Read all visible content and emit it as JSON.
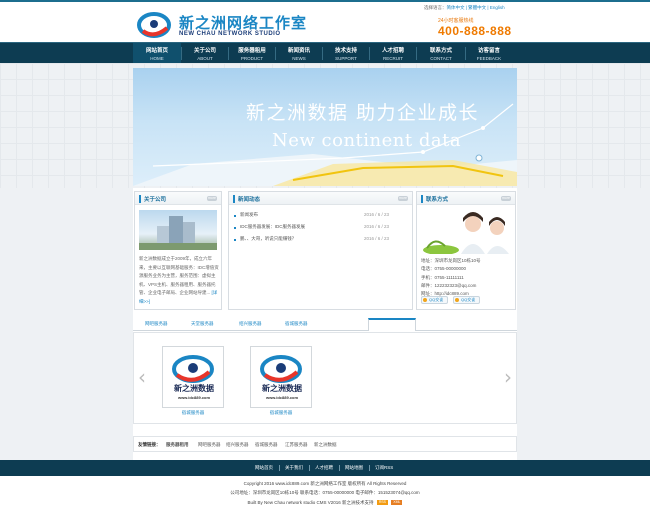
{
  "header": {
    "logo_title": "新之洲网络工作室",
    "logo_sub": "NEW CHAU NETWORK STUDIO",
    "lang_prefix": "选择语言：",
    "lang_options": "简体中文 | 繁體中文 | English",
    "hotline_label": "24小时客服热线",
    "hotline": "400-888-888"
  },
  "nav": [
    {
      "cn": "网站首页",
      "en": "HOME",
      "active": true
    },
    {
      "cn": "关于公司",
      "en": "ABOUT"
    },
    {
      "cn": "服务器租用",
      "en": "PRODUCT"
    },
    {
      "cn": "新闻资讯",
      "en": "NEWS"
    },
    {
      "cn": "技术支持",
      "en": "SUPPORT"
    },
    {
      "cn": "人才招聘",
      "en": "RECRUIT"
    },
    {
      "cn": "联系方式",
      "en": "CONTACT"
    },
    {
      "cn": "访客留言",
      "en": "FEEDBACK"
    }
  ],
  "banner": {
    "cn": "新之洲数据  助力企业成长",
    "en": "New continent data"
  },
  "about": {
    "title": "关于公司",
    "more": "more",
    "text": "新之洲数据成立于2009年，成立六年来，主要以互联网基础服务：IDC增值资源服务业务为主营，服务范围：虚拟主机、VPS主机、服务器租用、服务器托管、企业电子邮局、企业网站导建...",
    "read_more": "[详细>>]"
  },
  "news": {
    "title": "新闻动态",
    "more": "more",
    "items": [
      {
        "title": "新闻发布",
        "date": "2016 / 6 / 23"
      },
      {
        "title": "IDC服务器发展：IDC服务器发展",
        "date": "2016 / 6 / 23"
      },
      {
        "title": "鹏、、大哥，听说只能赚钱？",
        "date": "2016 / 6 / 23"
      }
    ]
  },
  "contact": {
    "title": "联系方式",
    "more": "more",
    "lines": [
      "地址：深圳市龙岗区10栋10号",
      "电话：0755-00000000",
      "手机：0755-11111111",
      "邮件：122232323@qq.com",
      "网址：http://idc889.com"
    ],
    "qq_label": "QQ交谈"
  },
  "tabs": [
    "网吧服务器",
    "天堂服务器",
    "绍兴服务器",
    "宿城服务器"
  ],
  "products": [
    {
      "cn": "新之洲数据",
      "url": "www.idc889.com",
      "name": "宿城服务器"
    },
    {
      "cn": "新之洲数据",
      "url": "www.idc889.com",
      "name": "宿城服务器"
    }
  ],
  "links": {
    "label": "友情链接：",
    "items": [
      "服务器租用",
      "网吧服务器",
      "绍兴服务器",
      "宿城服务器",
      "江苏服务器",
      "新之洲数据"
    ]
  },
  "footer_nav": [
    "网站首页",
    "关于我们",
    "人才招聘",
    "网站地图",
    "订阅RSS"
  ],
  "footer": {
    "copyright": "Copyright 2016 www.idc889.com 新之洲网络工作室 版权所有 All Rights Reserved",
    "address": "公司地址：深圳市龙岗区10栋10号 联系电话：0755-00000000 电子邮件：151523074@qq.com",
    "built": "Built By New Chau network studio CMS V2016 新之洲技术支持",
    "badges": [
      "RSS",
      "XML"
    ]
  },
  "colors": {
    "nav_bg": "#0d3c52",
    "accent": "#1a86c4",
    "hotline": "#ef7a00"
  }
}
